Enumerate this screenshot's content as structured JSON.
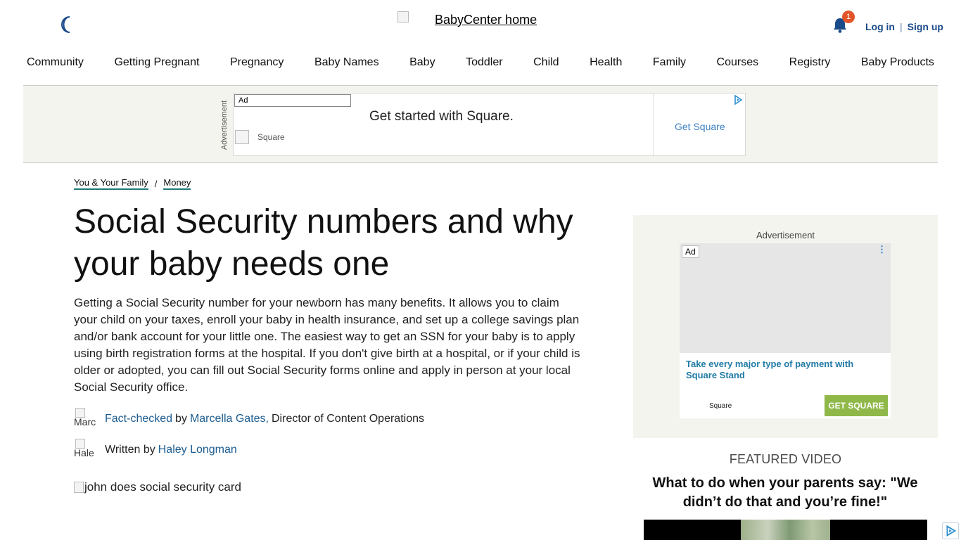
{
  "header": {
    "theme_toggle_icon": "moon-icon",
    "home_logo_alt": "BabyCenter home",
    "notification_icon": "bell-icon",
    "notification_count": "1",
    "login_label": "Log in",
    "auth_separator": "|",
    "signup_label": "Sign up"
  },
  "nav": {
    "items": [
      {
        "label": "Community"
      },
      {
        "label": "Getting Pregnant"
      },
      {
        "label": "Pregnancy"
      },
      {
        "label": "Baby Names"
      },
      {
        "label": "Baby"
      },
      {
        "label": "Toddler"
      },
      {
        "label": "Child"
      },
      {
        "label": "Health"
      },
      {
        "label": "Family"
      },
      {
        "label": "Courses"
      },
      {
        "label": "Registry"
      },
      {
        "label": "Baby Products"
      }
    ]
  },
  "top_ad": {
    "side_label": "Advertisement",
    "badge": "Ad",
    "headline": "Get started with Square.",
    "brand": "Square",
    "cta": "Get Square"
  },
  "breadcrumb": {
    "items": [
      {
        "label": "You & Your Family"
      },
      {
        "label": "Money"
      }
    ],
    "separator": "/"
  },
  "article": {
    "title": "Social Security numbers and why your baby needs one",
    "summary": "Getting a Social Security number for your newborn has many benefits. It allows you to claim your child on your taxes, enroll your baby in health insurance, and set up a college savings plan and/or bank account for your little one. The easiest way to get an SSN for your baby is to apply using birth registration forms at the hospital. If you don't give birth at a hospital, or if your child is older or adopted, you can fill out Social Security forms online and apply in person at your local Social Security office.",
    "fact_check": {
      "avatar_alt": "Marc",
      "link_label": "Fact-checked",
      "by": "by",
      "name": "Marcella Gates,",
      "role": "Director of Content Operations"
    },
    "written_by": {
      "avatar_alt": "Hale",
      "prefix": "Written by",
      "name": "Haley Longman"
    },
    "hero_image_alt": "john does social security card"
  },
  "rail_ad": {
    "label": "Advertisement",
    "badge": "Ad",
    "menu_icon": "more-vertical-icon",
    "headline": "Take every major type of payment with Square Stand",
    "brand": "Square",
    "cta": "GET SQUARE"
  },
  "featured_video": {
    "label": "FEATURED VIDEO",
    "title": "What to do when your parents say: \"We didn’t do that and you’re fine!\""
  },
  "colors": {
    "accent_teal": "#1f7b79",
    "link_blue": "#1b5b8f",
    "badge_orange": "#e2552a",
    "cta_green": "#8fb849",
    "ad_bg": "#f4f4ef"
  }
}
